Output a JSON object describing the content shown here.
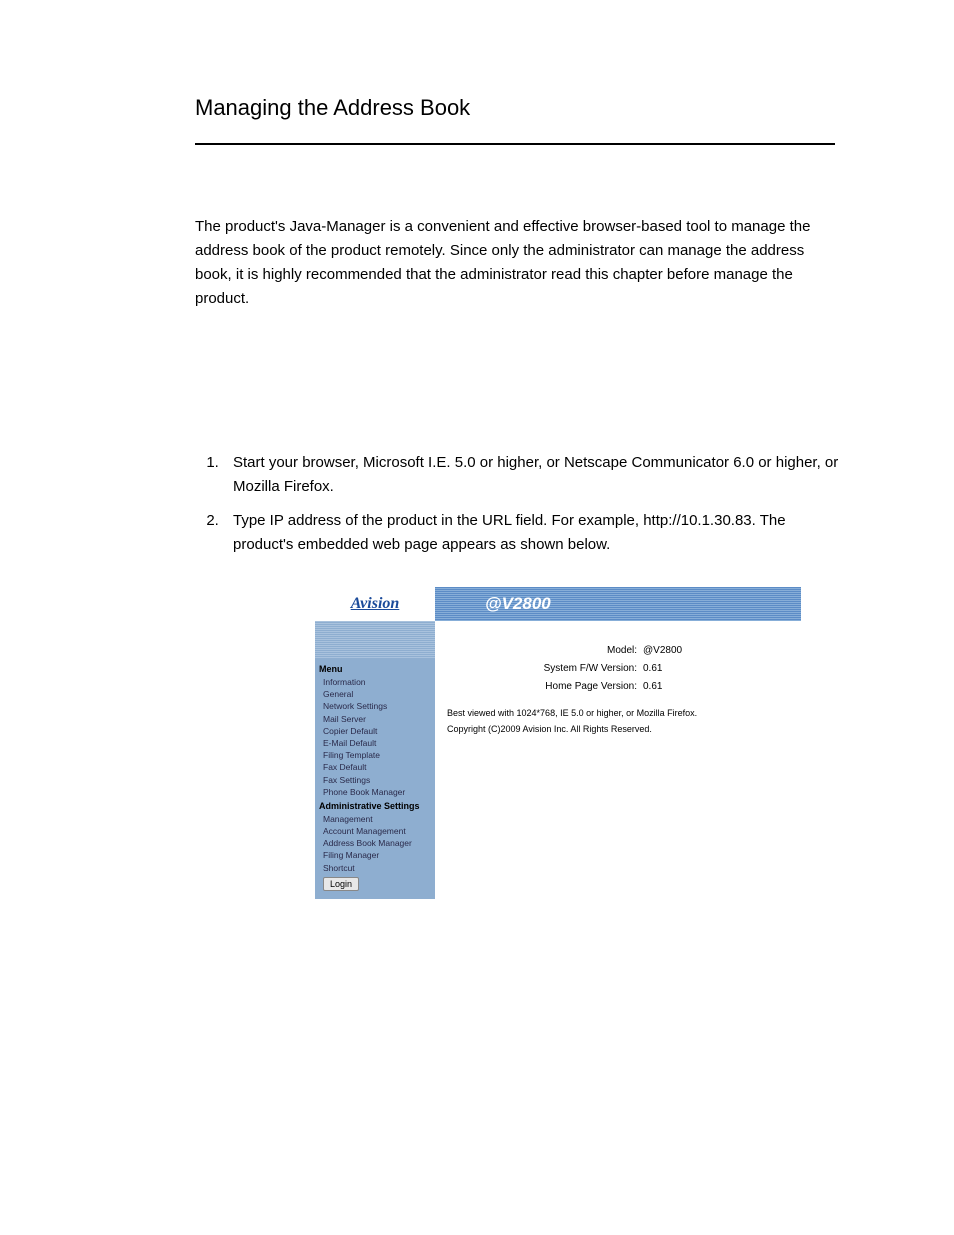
{
  "doc": {
    "title": "Managing the Address Book",
    "intro": "The product's Java-Manager is a convenient and effective browser-based tool to manage the address book of the product remotely.   Since only the administrator can manage the address book, it is highly recommended that the administrator read this chapter before manage the product.",
    "steps": [
      "Start your browser, Microsoft I.E. 5.0 or higher, or Netscape Communicator 6.0 or higher, or Mozilla Firefox.",
      "Type IP address of the product in the URL field.   For example, http://10.1.30.83.   The product's embedded web page appears as shown below."
    ]
  },
  "webpage": {
    "logo": "Avision",
    "product_title": "@V2800",
    "sidebar": {
      "menu_label": "Menu",
      "menu_items": [
        "Information",
        "General",
        "Network Settings",
        "Mail Server",
        "Copier Default",
        "E-Mail Default",
        "Filing Template",
        "Fax Default",
        "Fax Settings",
        "Phone Book Manager"
      ],
      "admin_label": "Administrative Settings",
      "admin_items": [
        "Management",
        "Account Management",
        "Address Book Manager",
        "Filing Manager",
        "Shortcut"
      ],
      "login_label": "Login"
    },
    "content": {
      "rows": [
        {
          "label": "Model:",
          "value": "@V2800"
        },
        {
          "label": "System F/W Version:",
          "value": "0.61"
        },
        {
          "label": "Home Page Version:",
          "value": "0.61"
        }
      ],
      "note": "Best viewed with 1024*768, IE 5.0 or higher, or Mozilla Firefox.",
      "copyright": "Copyright (C)2009 Avision Inc. All Rights Reserved."
    }
  }
}
